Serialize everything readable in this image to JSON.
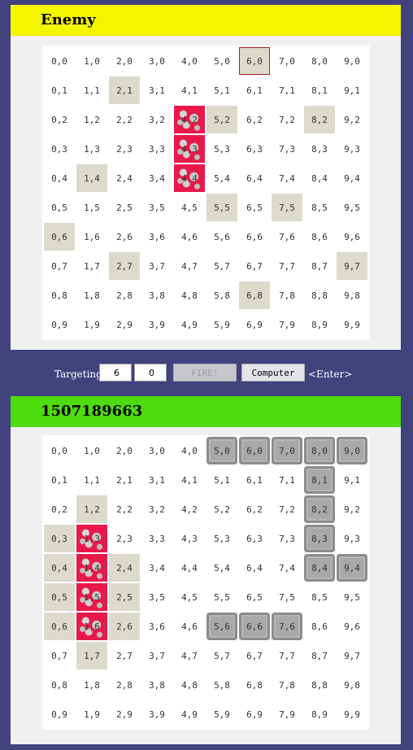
{
  "enemy": {
    "title": "Enemy",
    "header_color": "#f5f500",
    "selected": "6,0",
    "misses": [
      "2,1",
      "5,2",
      "8,2",
      "1,4",
      "5,5",
      "7,5",
      "0,6",
      "2,7",
      "9,7",
      "6,8"
    ],
    "hits": [
      "4,2",
      "4,3",
      "4,4"
    ],
    "ships": []
  },
  "targeting": {
    "label": "Targeting:",
    "x_value": "6",
    "y_value": "0",
    "fire_label": "FIRE!",
    "computer_label": "Computer",
    "enter_hint": "<Enter>"
  },
  "player": {
    "title": "1507189663",
    "header_color": "#4ddc0d",
    "selected": "",
    "misses": [
      "1,2",
      "0,3",
      "0,4",
      "2,4",
      "0,5",
      "2,5",
      "0,6",
      "2,6",
      "1,7"
    ],
    "hits": [
      "1,3",
      "1,4",
      "1,5",
      "1,6"
    ],
    "ships": [
      "5,0",
      "6,0",
      "7,0",
      "8,0",
      "9,0",
      "8,1",
      "8,2",
      "8,3",
      "8,4",
      "9,4",
      "5,6",
      "6,6",
      "7,6"
    ]
  },
  "colors": {
    "background": "#42427f",
    "miss": "#dcdacb",
    "hit": "#e8184a",
    "ship": "#a8a8a8"
  }
}
